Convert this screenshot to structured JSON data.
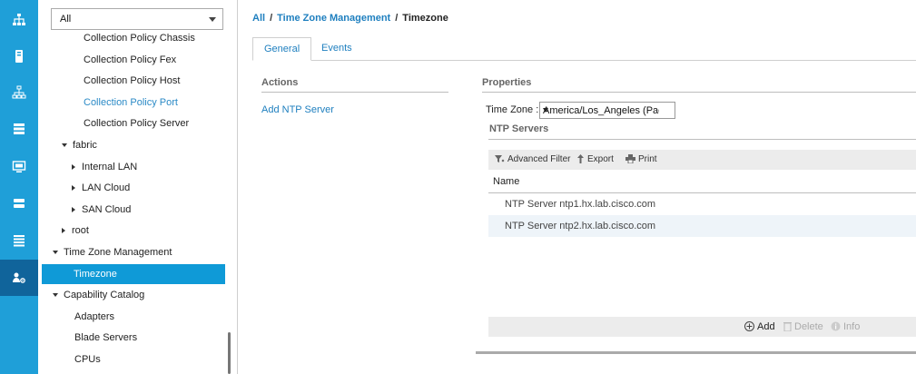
{
  "rail": {
    "items": [
      {
        "icon": "network-topology-icon"
      },
      {
        "icon": "server-icon"
      },
      {
        "icon": "lan-icon"
      },
      {
        "icon": "storage-stack-icon"
      },
      {
        "icon": "monitor-icon"
      },
      {
        "icon": "database-icon"
      },
      {
        "icon": "list-icon"
      },
      {
        "icon": "admin-settings-icon"
      }
    ],
    "accent": "#1f9fd8",
    "active_color": "#10649b"
  },
  "nav": {
    "filter_value": "All",
    "tree": [
      {
        "label": "Collection Policy Chassis",
        "indent": 50,
        "type": "leaf"
      },
      {
        "label": "Collection Policy Fex",
        "indent": 50,
        "type": "leaf"
      },
      {
        "label": "Collection Policy Host",
        "indent": 50,
        "type": "leaf"
      },
      {
        "label": "Collection Policy Port",
        "indent": 50,
        "type": "link"
      },
      {
        "label": "Collection Policy Server",
        "indent": 50,
        "type": "leaf"
      },
      {
        "label": "fabric",
        "indent": 26,
        "type": "expanded"
      },
      {
        "label": "Internal LAN",
        "indent": 37,
        "type": "collapsed"
      },
      {
        "label": "LAN Cloud",
        "indent": 37,
        "type": "collapsed"
      },
      {
        "label": "SAN Cloud",
        "indent": 37,
        "type": "collapsed"
      },
      {
        "label": "root",
        "indent": 26,
        "type": "collapsed"
      },
      {
        "label": "Time Zone Management",
        "indent": 16,
        "type": "expanded"
      },
      {
        "label": "Timezone",
        "indent": 40,
        "type": "selected"
      },
      {
        "label": "Capability Catalog",
        "indent": 16,
        "type": "expanded"
      },
      {
        "label": "Adapters",
        "indent": 40,
        "type": "leaf"
      },
      {
        "label": "Blade Servers",
        "indent": 40,
        "type": "leaf"
      },
      {
        "label": "CPUs",
        "indent": 40,
        "type": "leaf"
      }
    ]
  },
  "breadcrumb": {
    "all": "All",
    "section": "Time Zone Management",
    "current": "Timezone",
    "sep": "/"
  },
  "tabs": [
    "General",
    "Events"
  ],
  "actions": {
    "title": "Actions",
    "add_ntp": "Add NTP Server"
  },
  "properties": {
    "title": "Properties",
    "tz_label": "Time Zone :",
    "tz_value": "America/Los_Angeles (Pacif"
  },
  "ntp": {
    "title": "NTP Servers",
    "toolbar": {
      "filter": "Advanced Filter",
      "export": "Export",
      "print": "Print"
    },
    "column": "Name",
    "rows": [
      "NTP Server ntp1.hx.lab.cisco.com",
      "NTP Server ntp2.hx.lab.cisco.com"
    ],
    "footer": {
      "add": "Add",
      "delete": "Delete",
      "info": "Info"
    }
  }
}
